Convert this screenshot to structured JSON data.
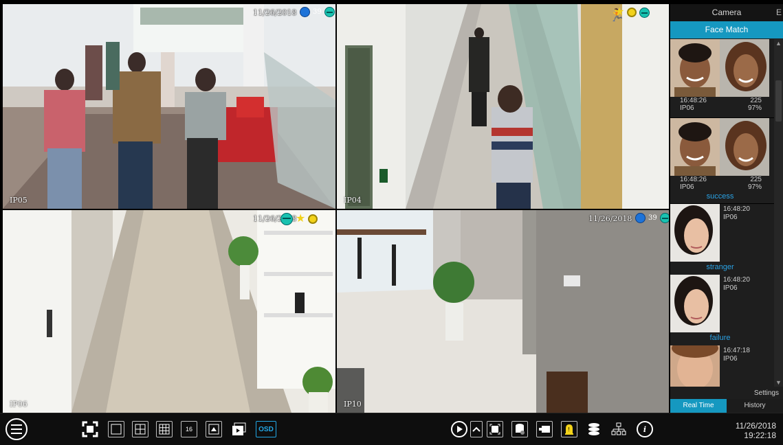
{
  "cameras": [
    {
      "label": "IP05",
      "time": "11/26/2018",
      "count": "39"
    },
    {
      "label": "IP04"
    },
    {
      "label": "IP06",
      "time": "11/26/2018"
    },
    {
      "label": "IP10",
      "time": "11/26/2018",
      "count": "39"
    }
  ],
  "panel": {
    "header": "Camera",
    "header_cut": "E",
    "facematch": "Face Match",
    "matches": [
      {
        "time": "16:48:26",
        "score": "225",
        "cam": "IP06",
        "pct": "97%"
      },
      {
        "time": "16:48:26",
        "score": "225",
        "cam": "IP06",
        "pct": "97%",
        "result": "success"
      }
    ],
    "singles": [
      {
        "time": "16:48:20",
        "cam": "IP06",
        "result": "stranger"
      },
      {
        "time": "16:48:20",
        "cam": "IP06",
        "result": "failure"
      },
      {
        "time": "16:47:18",
        "cam": "IP06"
      }
    ],
    "settings": "Settings",
    "tab_realtime": "Real Time",
    "tab_history": "History"
  },
  "toolbar": {
    "osd": "OSD",
    "layout16": "16"
  },
  "clock": {
    "date": "11/26/2018",
    "time": "19:22:18"
  },
  "colors": {
    "accent": "#1598c0",
    "success": "#2aa3e6",
    "alarm": "#f2d21a"
  }
}
